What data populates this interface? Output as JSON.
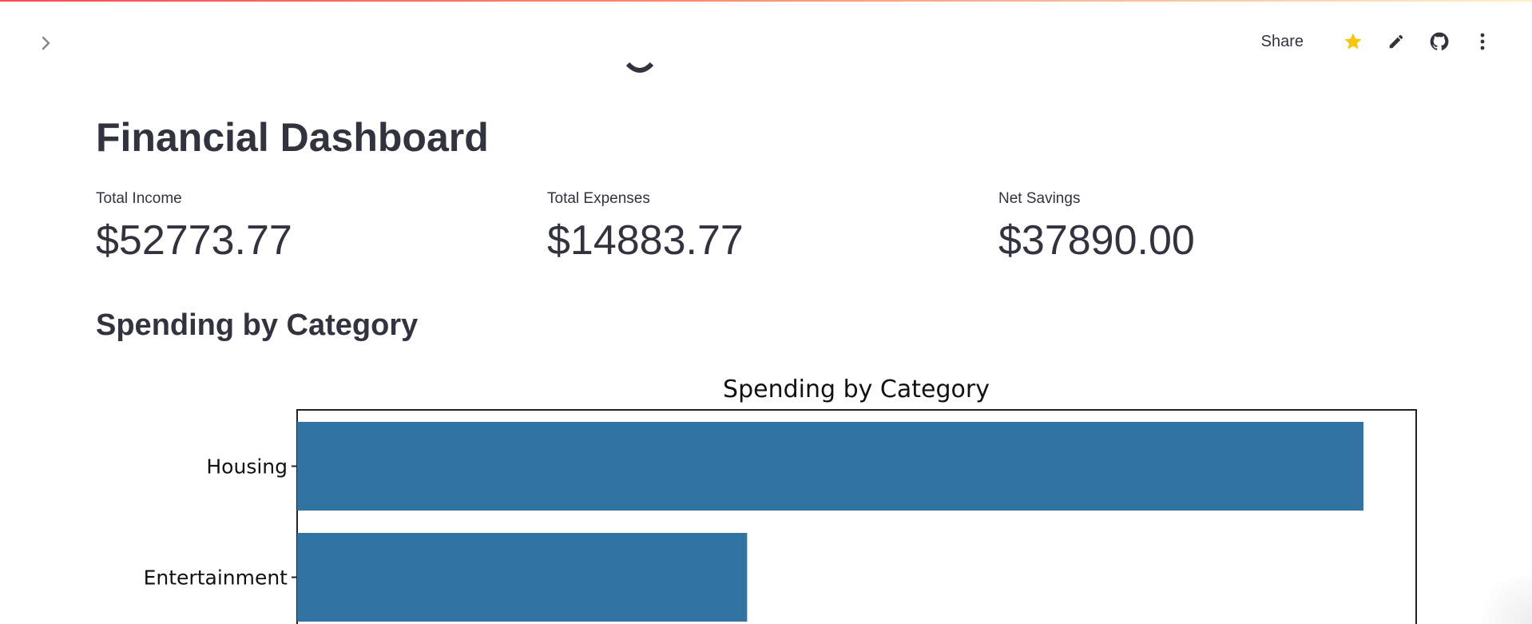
{
  "header": {
    "share_label": "Share",
    "icons": [
      "star-icon",
      "pencil-icon",
      "github-icon",
      "more-vertical-icon"
    ],
    "star_color": "#f9c513"
  },
  "sidebar": {
    "toggle_icon": "chevron-right-icon"
  },
  "main": {
    "title": "Financial Dashboard",
    "metrics": [
      {
        "label": "Total Income",
        "value": "$52773.77"
      },
      {
        "label": "Total Expenses",
        "value": "$14883.77"
      },
      {
        "label": "Net Savings",
        "value": "$37890.00"
      }
    ],
    "section_title": "Spending by Category"
  },
  "colors": {
    "text": "#31333f",
    "bar": "#3274a1",
    "accent_stripe": "#ff4b4b"
  },
  "chart_data": {
    "type": "bar",
    "orientation": "horizontal",
    "title": "Spending by Category",
    "categories": [
      "Housing",
      "Entertainment"
    ],
    "values": [
      1.0,
      0.422
    ],
    "grid": false
  }
}
